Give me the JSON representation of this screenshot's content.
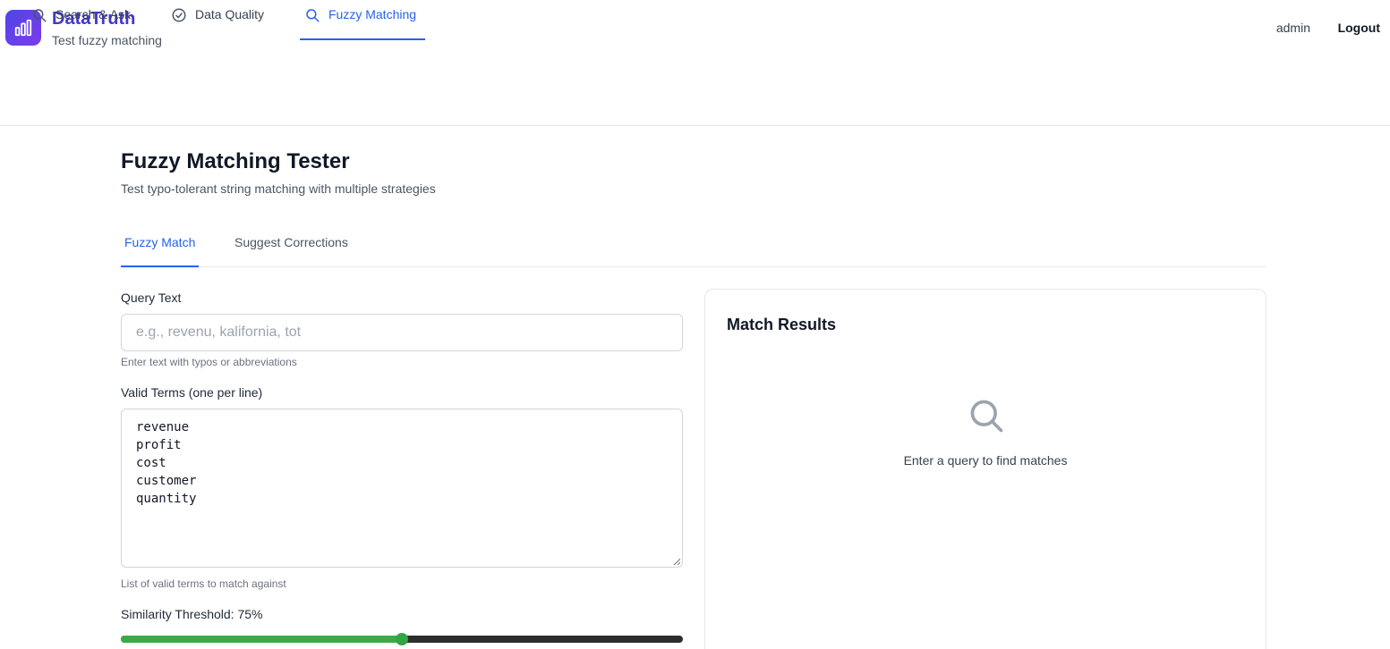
{
  "app": {
    "title": "DataTruth",
    "subtitle": "Test fuzzy matching",
    "logo_icon": "bar-chart-icon"
  },
  "user": {
    "name": "admin",
    "logout_label": "Logout"
  },
  "nav": {
    "items": [
      {
        "label": "Search & Ask",
        "icon": "search-icon",
        "active": false
      },
      {
        "label": "Data Quality",
        "icon": "check-circle-icon",
        "active": false
      },
      {
        "label": "Fuzzy Matching",
        "icon": "search-icon",
        "active": true
      }
    ]
  },
  "page": {
    "title": "Fuzzy Matching Tester",
    "description": "Test typo-tolerant string matching with multiple strategies"
  },
  "tabs": [
    {
      "label": "Fuzzy Match",
      "active": true
    },
    {
      "label": "Suggest Corrections",
      "active": false
    }
  ],
  "form": {
    "query_label": "Query Text",
    "query_placeholder": "e.g., revenu, kalifornia, tot",
    "query_value": "",
    "query_hint": "Enter text with typos or abbreviations",
    "terms_label": "Valid Terms (one per line)",
    "terms": [
      "revenue",
      "profit",
      "cost",
      "customer",
      "quantity"
    ],
    "terms_hint": "List of valid terms to match against",
    "threshold_label": "Similarity Threshold: 75%",
    "threshold_value": 0.5
  },
  "results": {
    "title": "Match Results",
    "empty_text": "Enter a query to find matches",
    "empty_icon": "search-icon"
  },
  "colors": {
    "brand": "#4f46e5",
    "accent": "#2563eb",
    "slider_fill": "#3cab47"
  }
}
